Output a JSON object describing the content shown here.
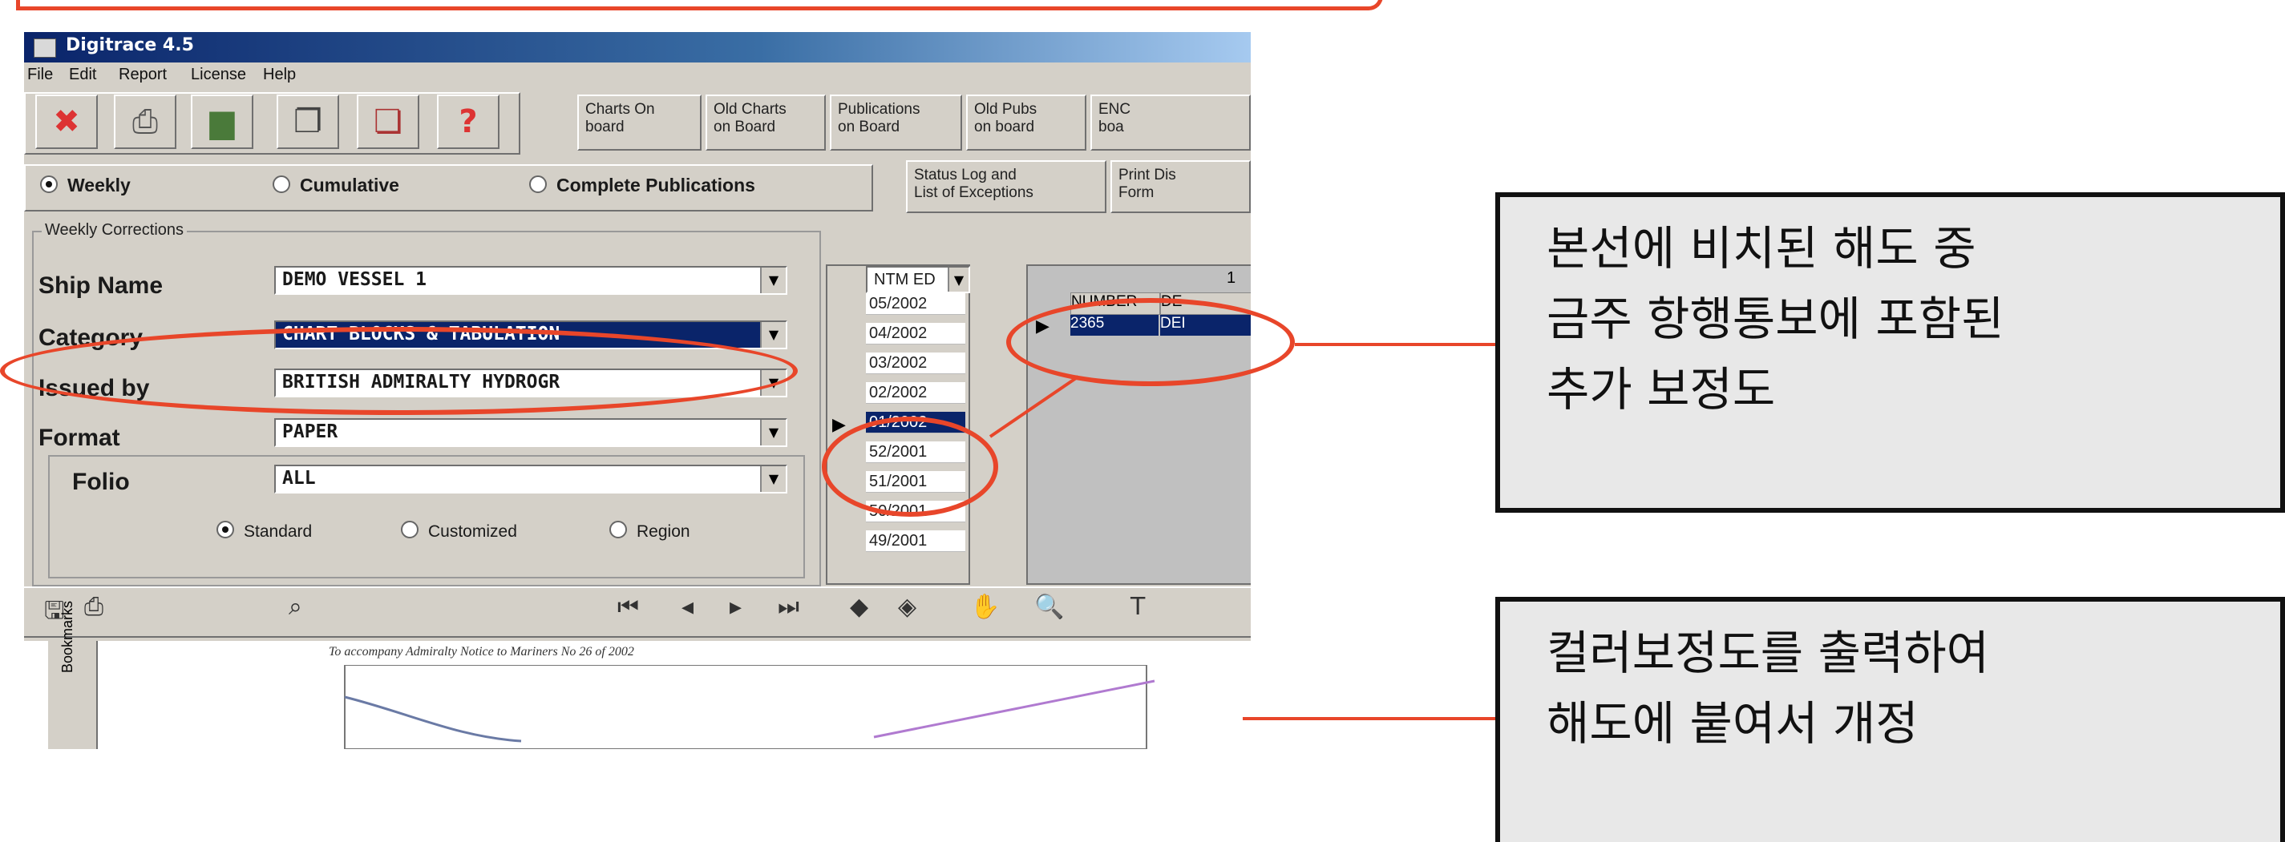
{
  "window": {
    "title": "Digitrace 4.5"
  },
  "menu": [
    "File",
    "Edit",
    "Report",
    "License",
    "Help"
  ],
  "toolbar": {
    "icons": [
      "delete-icon",
      "print-icon",
      "printer-color-icon",
      "chart-copy-icon",
      "chart-stack-icon",
      "help-icon"
    ],
    "help_glyph": "?",
    "nav_buttons": [
      "Charts On\nboard",
      "Old Charts\non Board",
      "Publications\non Board",
      "Old Pubs\non board",
      "ENC\nboa"
    ]
  },
  "mode_radios": [
    {
      "label": "Weekly",
      "selected": true
    },
    {
      "label": "Cumulative",
      "selected": false
    },
    {
      "label": "Complete Publications",
      "selected": false
    }
  ],
  "status_button": "Status Log and\nList of Exceptions",
  "print_button": "Print Dis\nForm",
  "group_label": "Weekly Corrections",
  "fields": {
    "ship_name": {
      "label": "Ship Name",
      "value": "DEMO VESSEL 1"
    },
    "category": {
      "label": "Category",
      "value": "CHART BLOCKS & TABULATION"
    },
    "issued_by": {
      "label": "Issued by",
      "value": "BRITISH ADMIRALTY HYDROGR"
    },
    "format": {
      "label": "Format",
      "value": "PAPER"
    },
    "folio": {
      "label": "Folio",
      "value": "ALL"
    }
  },
  "folio_radios": [
    {
      "label": "Standard",
      "selected": true
    },
    {
      "label": "Customized",
      "selected": false
    },
    {
      "label": "Region",
      "selected": false
    }
  ],
  "ntm_list": {
    "header": "NTM ED",
    "items": [
      "05/2002",
      "04/2002",
      "03/2002",
      "02/2002",
      "01/2002",
      "52/2001",
      "51/2001",
      "50/2001",
      "49/2001"
    ],
    "selected_index": 4
  },
  "grid": {
    "title": "1",
    "columns": [
      "NUMBER",
      "DE"
    ],
    "rows": [
      [
        "2365",
        "DEI"
      ]
    ]
  },
  "viewer_tab": "Bookmarks",
  "doc_caption": "To accompany Admiralty Notice to Mariners No 26 of 2002",
  "annotations": {
    "callout1": [
      "본선에 비치된 해도 중",
      "금주 항행통보에 포함된",
      "추가 보정도"
    ],
    "callout2": [
      "컬러보정도를 출력하여",
      "해도에 붙여서 개정"
    ]
  },
  "colors": {
    "accent_red": "#e8462a",
    "titlebar": "#0a246a",
    "window_bg": "#d4d0c8"
  }
}
